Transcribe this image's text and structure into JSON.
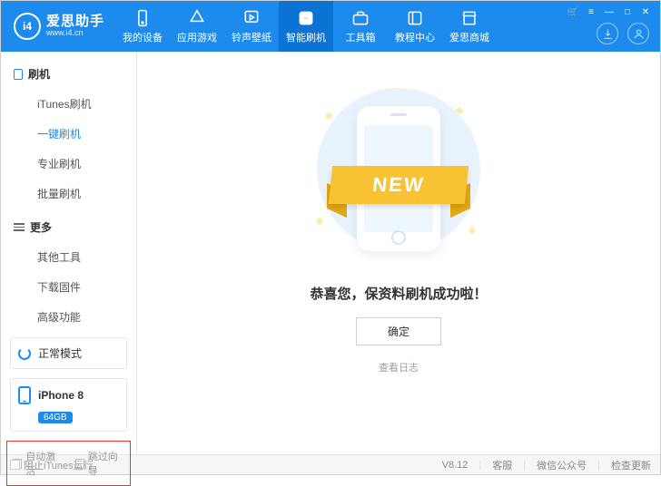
{
  "brand": {
    "name": "爱思助手",
    "url": "www.i4.cn",
    "logo_text": "i4"
  },
  "window_controls": {
    "cart": "🛒",
    "settings": "≡",
    "min": "—",
    "max": "□",
    "close": "✕"
  },
  "header_circles": {
    "download": "download",
    "user": "user"
  },
  "nav": [
    {
      "label": "我的设备",
      "icon": "device"
    },
    {
      "label": "应用游戏",
      "icon": "apps"
    },
    {
      "label": "铃声壁纸",
      "icon": "music"
    },
    {
      "label": "智能刷机",
      "icon": "flash",
      "active": true
    },
    {
      "label": "工具箱",
      "icon": "toolbox"
    },
    {
      "label": "教程中心",
      "icon": "book"
    },
    {
      "label": "爱思商城",
      "icon": "store"
    }
  ],
  "sidebar": {
    "groups": [
      {
        "title": "刷机",
        "icon": "device",
        "items": [
          "iTunes刷机",
          "一键刷机",
          "专业刷机",
          "批量刷机"
        ],
        "selected": "一键刷机"
      },
      {
        "title": "更多",
        "icon": "menu",
        "items": [
          "其他工具",
          "下载固件",
          "高级功能"
        ]
      }
    ],
    "mode": "正常模式",
    "device": {
      "name": "iPhone 8",
      "storage": "64GB"
    },
    "options": {
      "auto_activate": "自动激活",
      "skip_setup": "跳过向导"
    }
  },
  "main": {
    "ribbon": "NEW",
    "message": "恭喜您，保资料刷机成功啦！",
    "ok": "确定",
    "log": "查看日志"
  },
  "statusbar": {
    "block_itunes": "阻止iTunes运行",
    "version": "V8.12",
    "support": "客服",
    "wechat": "微信公众号",
    "update": "检查更新"
  }
}
